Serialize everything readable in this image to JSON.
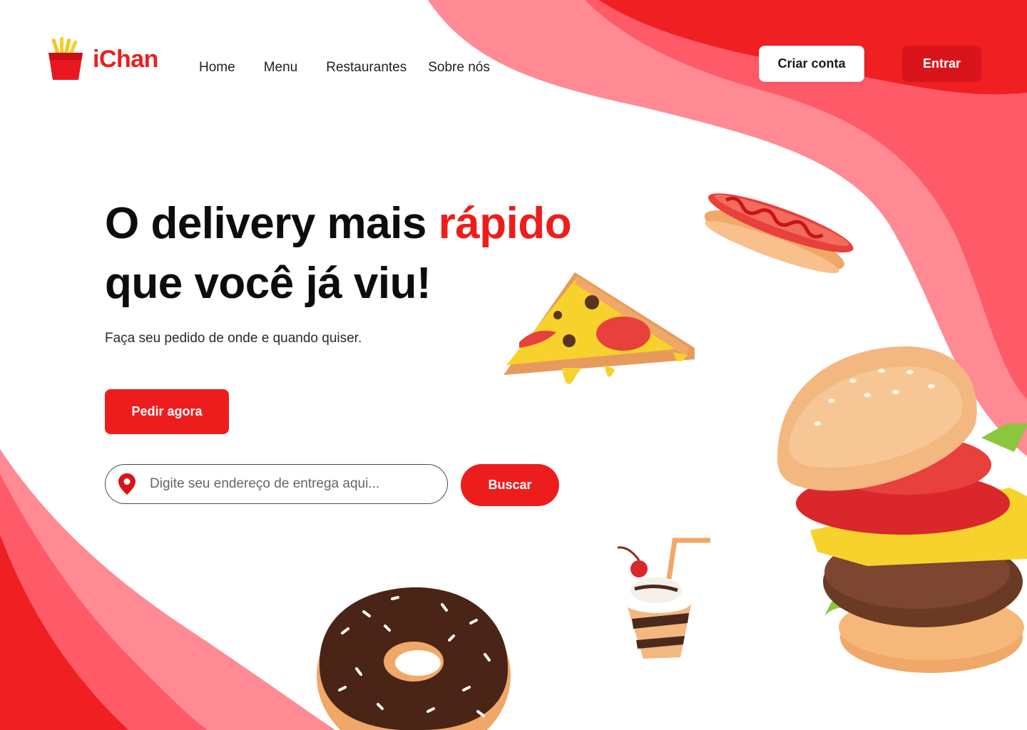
{
  "brand": {
    "name": "iChan",
    "logo_icon": "fries-box-icon",
    "color": "#ee1d1d"
  },
  "nav": {
    "items": [
      "Home",
      "Menu",
      "Restaurantes",
      "Sobre nós"
    ]
  },
  "header": {
    "signup_label": "Criar conta",
    "login_label": "Entrar"
  },
  "hero": {
    "title_part1": "O delivery mais ",
    "title_accent": "rápido",
    "title_part2": "que você já viu!",
    "subtitle": "Faça seu pedido de onde e quando quiser.",
    "order_button": "Pedir agora"
  },
  "search": {
    "placeholder": "Digite seu endereço de entrega aqui...",
    "value": "",
    "button": "Buscar",
    "icon": "location-pin-icon"
  },
  "illustrations": [
    "hot-dog",
    "pizza-slice",
    "burger",
    "milkshake",
    "donut"
  ],
  "colors": {
    "primary": "#ee1d1d",
    "dark_red": "#d9141a",
    "light_red": "#ff5a68",
    "pink": "#ff8a93"
  }
}
